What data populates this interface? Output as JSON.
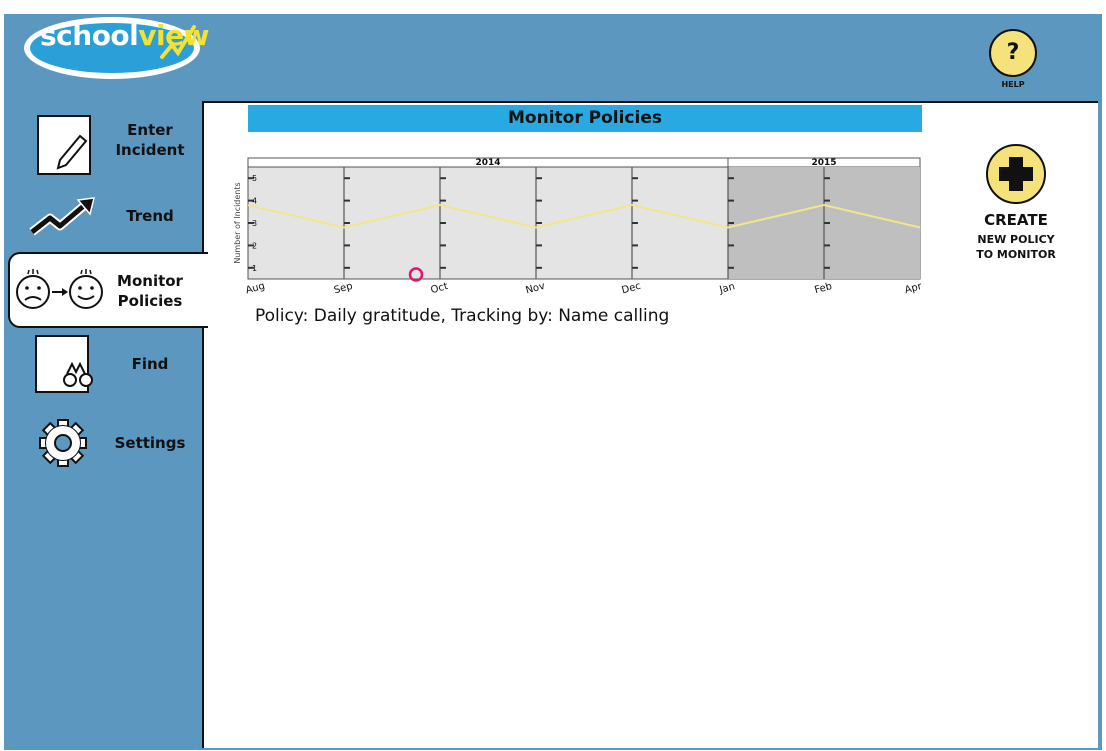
{
  "logo": {
    "part1": "school",
    "part2": "view"
  },
  "help": {
    "icon": "?",
    "label": "HELP"
  },
  "nav": {
    "enter_incident": {
      "line1": "Enter",
      "line2": "Incident"
    },
    "trend": {
      "label": "Trend"
    },
    "monitor_policies": {
      "line1": "Monitor",
      "line2": "Policies"
    },
    "find": {
      "label": "Find"
    },
    "settings": {
      "label": "Settings"
    }
  },
  "main": {
    "section_title": "Monitor Policies",
    "policy_text": "Policy: Daily gratitude, Tracking by: Name calling"
  },
  "create": {
    "title": "CREATE",
    "line1": "NEW POLICY",
    "line2": "TO MONITOR"
  },
  "colors": {
    "accent_blue": "#29a9e1",
    "sidebar": "#5b97bf",
    "yellow": "#f6e27a",
    "line_yellow": "#f3e58a",
    "marker_pink": "#e0156b"
  },
  "chart_data": {
    "type": "line",
    "ylabel": "Number of Incidents",
    "year_labels": [
      "2014",
      "2015"
    ],
    "categories": [
      "Aug",
      "Sep",
      "Oct",
      "Nov",
      "Dec",
      "Jan",
      "Feb",
      "Apr"
    ],
    "y_ticks": [
      "1",
      "2",
      "3",
      "4",
      "5"
    ],
    "ylim": [
      0.5,
      5.5
    ],
    "series": [
      {
        "values": [
          3.8,
          2.8,
          3.8,
          2.8,
          3.8,
          2.8,
          3.8,
          2.8
        ]
      }
    ],
    "shaded_region": {
      "from": "Jan",
      "to": "Apr"
    },
    "marker": {
      "between": [
        "Sep",
        "Oct"
      ],
      "value": 0.7
    }
  }
}
